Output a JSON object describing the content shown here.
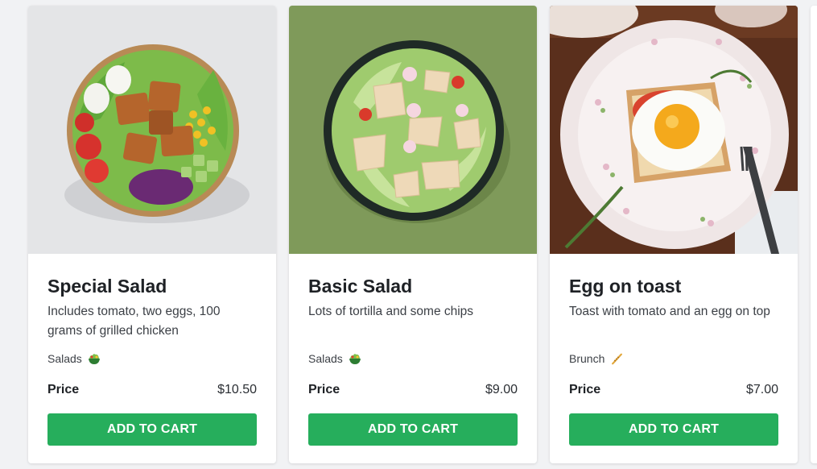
{
  "products": [
    {
      "title": "Special Salad",
      "description": "Includes tomato, two eggs, 100 grams of grilled chicken",
      "category": "Salads",
      "category_icon": "salad-emoji-icon",
      "price_label": "Price",
      "price": "$10.50",
      "button_label": "ADD TO CART",
      "image": "salad-bowl-with-chicken-image"
    },
    {
      "title": "Basic Salad",
      "description": "Lots of tortilla and some chips",
      "category": "Salads",
      "category_icon": "salad-emoji-icon",
      "price_label": "Price",
      "price": "$9.00",
      "button_label": "ADD TO CART",
      "image": "salad-bowl-with-tortilla-image"
    },
    {
      "title": "Egg on toast",
      "description": "Toast with tomato and an egg on top",
      "category": "Brunch",
      "category_icon": "baguette-emoji-icon",
      "price_label": "Price",
      "price": "$7.00",
      "button_label": "ADD TO CART",
      "image": "egg-on-toast-plate-image"
    }
  ],
  "colors": {
    "accent": "#26ae5c",
    "page_background": "#f1f2f4",
    "card_background": "#ffffff"
  }
}
